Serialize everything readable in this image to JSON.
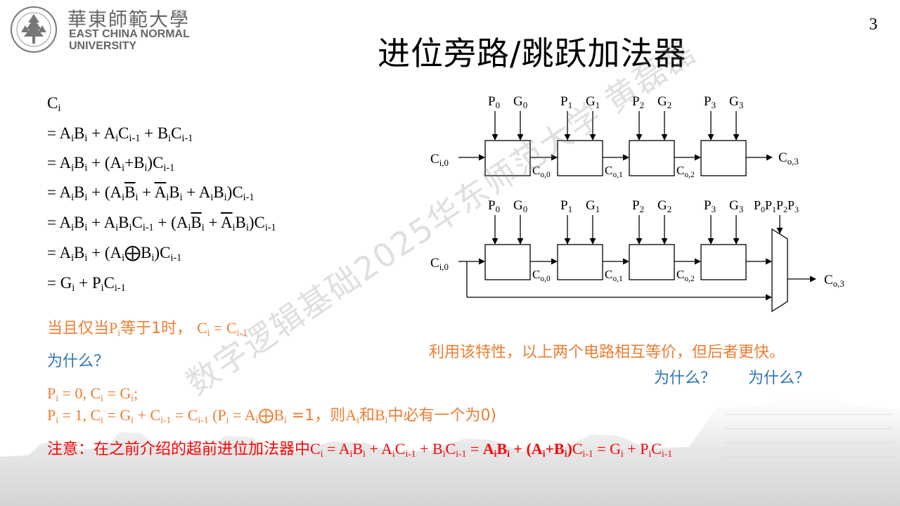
{
  "header": {
    "university_cn": "華東師範大學",
    "university_en_line1": "EAST CHINA NORMAL",
    "university_en_line2": "UNIVERSITY",
    "page_number": "3"
  },
  "title": "进位旁路/跳跃加法器",
  "derivation": {
    "c": "C",
    "sub_i": "i",
    "sub_im1": "i-1",
    "a": "A",
    "b": "B",
    "g": "G",
    "p": "P",
    "eq": "= ",
    "plus": " + ",
    "lp": "(",
    "rp": ")",
    "inner_plus": "+",
    "xor": "⨁"
  },
  "condition": {
    "text_prefix": "当且仅当",
    "text_mid": "等于1时，  ",
    "why1": "为什么？"
  },
  "cases": {
    "line1_p0": "P",
    "line1_a": " = 0, ",
    "line1_b": " = ",
    "line1_end": ";",
    "line2_a": " = 1, ",
    "line2_b": " = ",
    "line2_c": " + ",
    "line2_d": " = ",
    "line2_paren_open": "    (",
    "line2_eq": " = ",
    "line2_eq1": " =1，则",
    "line2_and": "和",
    "line2_tail": "中必有一个为0)"
  },
  "note": {
    "prefix": "注意：在之前介绍的超前进位加法器中",
    "eq": " = ",
    "plus": " + "
  },
  "diagram": {
    "inputs_top": [
      "P",
      "G"
    ],
    "subs": [
      "0",
      "1",
      "2",
      "3"
    ],
    "cin_label": "C",
    "cin_sub": "i,0",
    "co_label": "C",
    "co_subs": [
      "o,0",
      "o,1",
      "o,2",
      "o,3"
    ],
    "mux_label": "P0P1P2P3"
  },
  "comments": {
    "equivalence": "利用该特性，以上两个电路相互等价，但后者更快。",
    "why2": "为什么？",
    "why3": "为什么？"
  },
  "watermark": "数字逻辑基础2025华东师范大学 黄磊磊",
  "colors": {
    "orange": "#ED7D31",
    "blue": "#2E75B6",
    "red": "#FF0000"
  }
}
